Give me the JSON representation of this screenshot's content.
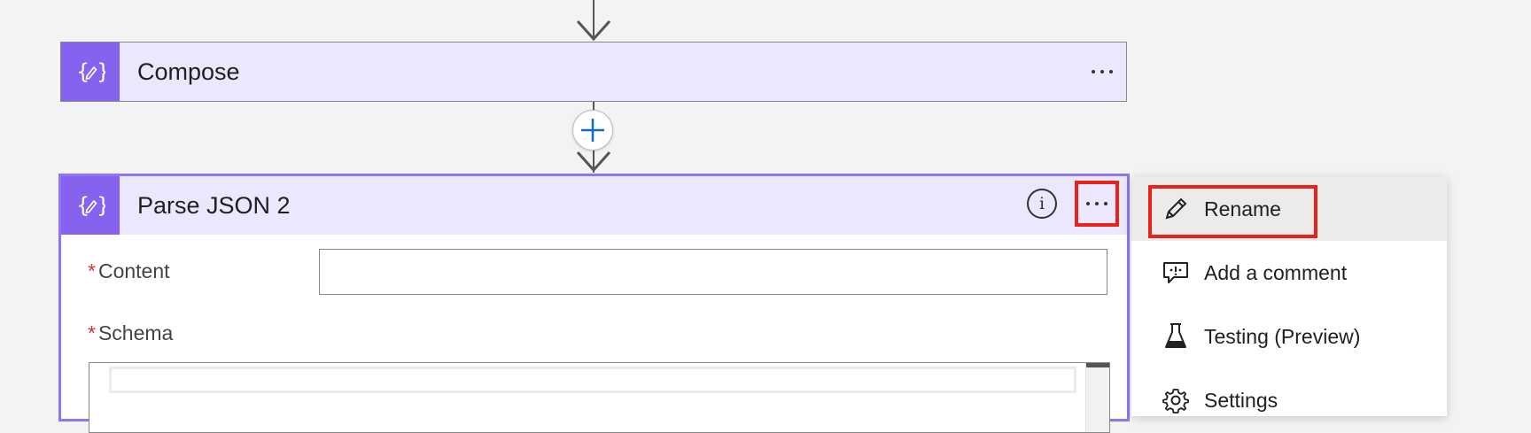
{
  "flow": {
    "compose": {
      "title": "Compose",
      "icon": "compose-icon",
      "accent": "#8762ee",
      "header_bg": "#ebe7fd"
    },
    "add_step": {
      "icon": "plus-icon",
      "color": "#0f6cbd"
    },
    "parse_json": {
      "title": "Parse JSON 2",
      "icon": "compose-icon",
      "info_icon": "info-icon",
      "border_color": "#8f75ef",
      "fields": {
        "content_required": "*",
        "content_label": "Content",
        "content_value": "",
        "schema_required": "*",
        "schema_label": "Schema"
      }
    }
  },
  "context_menu": {
    "items": [
      {
        "label": "Rename",
        "icon": "pencil-icon"
      },
      {
        "label": "Add a comment",
        "icon": "comment-icon"
      },
      {
        "label": "Testing (Preview)",
        "icon": "flask-icon"
      },
      {
        "label": "Settings",
        "icon": "gear-icon"
      }
    ],
    "highlight_color": "#e8231b"
  }
}
